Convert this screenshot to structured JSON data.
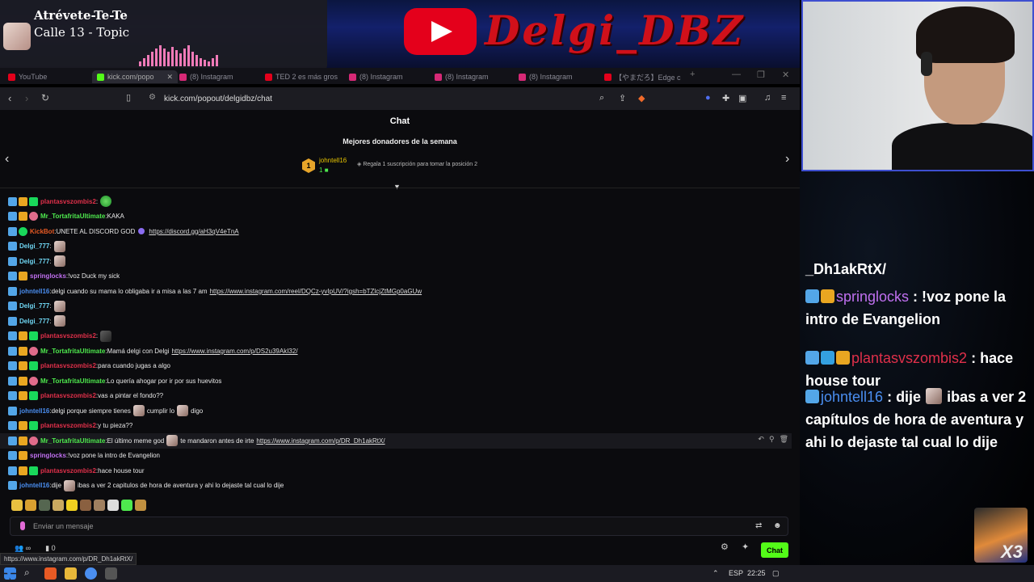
{
  "now_playing": {
    "title": "Atrévete-Te-Te",
    "artist": "Calle 13 - Topic"
  },
  "banner": {
    "brand": "Delgi_DBZ"
  },
  "browser": {
    "tabs": [
      {
        "label": "YouTube",
        "color": "#e4001b"
      },
      {
        "label": "kick.com/popo",
        "color": "#53fc18",
        "active": true
      },
      {
        "label": "(8) Instagram",
        "color": "#d62976"
      },
      {
        "label": "TED 2 es más gros",
        "color": "#e4001b"
      },
      {
        "label": "(8) Instagram",
        "color": "#d62976"
      },
      {
        "label": "(8) Instagram",
        "color": "#d62976"
      },
      {
        "label": "(8) Instagram",
        "color": "#d62976"
      },
      {
        "label": "【やまだろ】Edge c",
        "color": "#e4001b"
      }
    ],
    "url": "kick.com/popout/delgidbz/chat"
  },
  "chat": {
    "header": "Chat",
    "donors_title": "Mejores donadores de la semana",
    "top_donor": {
      "rank": "1",
      "name": "johntell16",
      "count": "1",
      "cta": "Regala 1 suscripción para tomar la posición 2"
    },
    "input_placeholder": "Enviar un mensaje",
    "viewers": "0",
    "send_label": "Chat",
    "status_url": "https://www.instagram.com/p/DR_Dh1akRtX/"
  },
  "colors": {
    "kick_green": "#53fc18",
    "user_green": "#4ee94e",
    "user_red": "#e0304a",
    "user_purple": "#c070f0",
    "user_blue": "#4a8ef0",
    "user_orange": "#e85a24",
    "user_teal": "#6fd6f3"
  },
  "messages": [
    {
      "user": "plantasvszombis2",
      "ucolor": "#e0304a",
      "badges": [
        "mod",
        "vip",
        "sub"
      ],
      "text": "",
      "emotes_after_user": [
        "green"
      ]
    },
    {
      "user": "Mr_TortafritaUltimate",
      "ucolor": "#4ee94e",
      "badges": [
        "mod",
        "vip",
        "gift"
      ],
      "text": "KAKA"
    },
    {
      "user": "KickBot",
      "ucolor": "#e85a24",
      "badges": [
        "mod",
        "ok"
      ],
      "text": "UNETE AL DISCORD GOD",
      "link": "https://discord.gg/aH3qV4eTnA",
      "pre_link_emote": true
    },
    {
      "user": "Delgi_777",
      "ucolor": "#6fd6f3",
      "badges": [
        "mod"
      ],
      "text": "",
      "emotes_after_user": [
        "face"
      ]
    },
    {
      "user": "Delgi_777",
      "ucolor": "#6fd6f3",
      "badges": [
        "mod"
      ],
      "text": "",
      "emotes_after_user": [
        "face"
      ]
    },
    {
      "user": "springlocks",
      "ucolor": "#c070f0",
      "badges": [
        "mod",
        "vip"
      ],
      "text": "!voz Duck my sick"
    },
    {
      "user": "johntell16",
      "ucolor": "#4a8ef0",
      "badges": [
        "mod"
      ],
      "text": "delgi cuando su mama lo obligaba ir a misa a las 7 am",
      "link": "https://www.instagram.com/reel/DQCz-yvIpUV/?igsh=bTZlcjZtMGp0aGUw"
    },
    {
      "user": "Delgi_777",
      "ucolor": "#6fd6f3",
      "badges": [
        "mod"
      ],
      "text": "",
      "emotes_after_user": [
        "face"
      ]
    },
    {
      "user": "Delgi_777",
      "ucolor": "#6fd6f3",
      "badges": [
        "mod"
      ],
      "text": "",
      "emotes_after_user": [
        "face"
      ]
    },
    {
      "user": "plantasvszombis2",
      "ucolor": "#e0304a",
      "badges": [
        "mod",
        "vip",
        "sub"
      ],
      "text": "",
      "emotes_after_user": [
        "dark"
      ]
    },
    {
      "user": "Mr_TortafritaUltimate",
      "ucolor": "#4ee94e",
      "badges": [
        "mod",
        "vip",
        "gift"
      ],
      "text": "Mamá delgi con Delgi",
      "link": "https://www.instagram.com/p/DS2u39AkI32/"
    },
    {
      "user": "plantasvszombis2",
      "ucolor": "#e0304a",
      "badges": [
        "mod",
        "vip",
        "sub"
      ],
      "text": "para cuando jugas a algo"
    },
    {
      "user": "Mr_TortafritaUltimate",
      "ucolor": "#4ee94e",
      "badges": [
        "mod",
        "vip",
        "gift"
      ],
      "text": "Lo quería ahogar por ir por sus huevitos"
    },
    {
      "user": "plantasvszombis2",
      "ucolor": "#e0304a",
      "badges": [
        "mod",
        "vip",
        "sub"
      ],
      "text": "vas a pintar el fondo??"
    },
    {
      "user": "johntell16",
      "ucolor": "#4a8ef0",
      "badges": [
        "mod"
      ],
      "text": "delgi porque siempre tienes",
      "mid_emote": true,
      "text2": "cumplir lo",
      "mid_emote2": true,
      "text3": "digo"
    },
    {
      "user": "plantasvszombis2",
      "ucolor": "#e0304a",
      "badges": [
        "mod",
        "vip",
        "sub"
      ],
      "text": "y tu pieza??"
    },
    {
      "user": "Mr_TortafritaUltimate",
      "ucolor": "#4ee94e",
      "badges": [
        "mod",
        "vip",
        "gift"
      ],
      "text": "El último meme god",
      "mid_emote": true,
      "text2": "te mandaron antes de irte",
      "link": "https://www.instagram.com/p/DR_Dh1akRtX/",
      "hover": true
    },
    {
      "user": "springlocks",
      "ucolor": "#c070f0",
      "badges": [
        "mod",
        "vip"
      ],
      "text": "!voz pone la intro de Evangelion"
    },
    {
      "user": "plantasvszombis2",
      "ucolor": "#e0304a",
      "badges": [
        "mod",
        "vip",
        "sub"
      ],
      "text": "hace house tour"
    },
    {
      "user": "johntell16",
      "ucolor": "#4a8ef0",
      "badges": [
        "mod"
      ],
      "text": "dije",
      "mid_emote": true,
      "text2": "ibas a ver 2 capitulos de hora de aventura y ahi lo dejaste tal cual lo dije"
    }
  ],
  "overlay_chat": {
    "partial_user": "_Dh1akRtX/",
    "messages": [
      {
        "user": "springlocks",
        "ucolor": "#c070f0",
        "badges": [
          "mod",
          "vip"
        ],
        "text": "!voz pone la intro de Evangelion"
      },
      {
        "user": "plantasvszombis2",
        "ucolor": "#e0304a",
        "badges": [
          "mod",
          "cube",
          "vip"
        ],
        "text": "hace house tour"
      },
      {
        "user": "johntell16",
        "ucolor": "#4a8ef0",
        "badges": [
          "mod"
        ],
        "text": "dije",
        "emote": true,
        "text2": "ibas a ver 2 capítulos de hora de aventura y ahi lo dejaste tal cual lo dije"
      }
    ]
  },
  "taskbar": {
    "lang": "ESP",
    "time": "22:25"
  },
  "corner_badge": "X3"
}
